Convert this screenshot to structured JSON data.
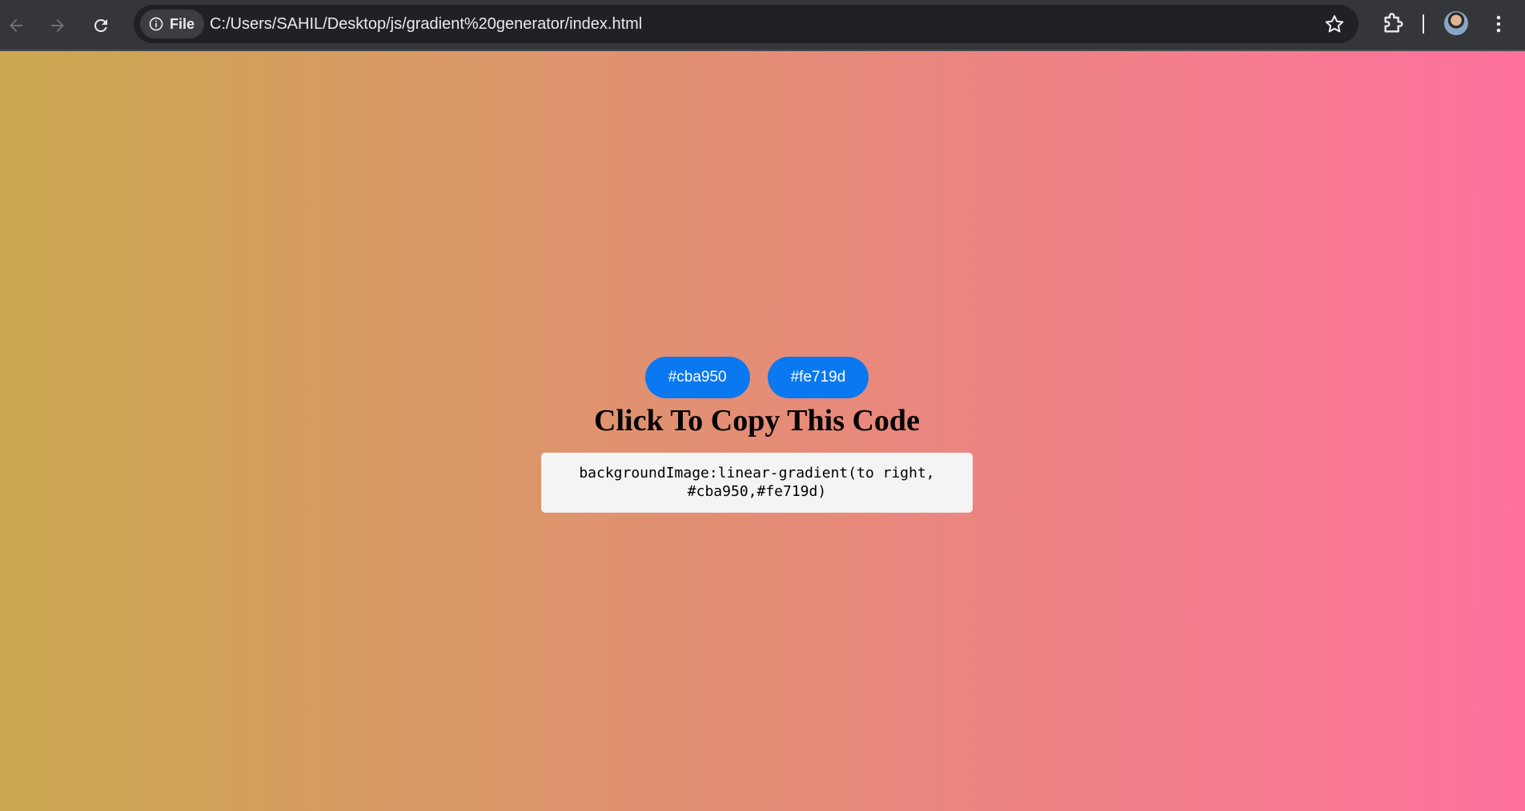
{
  "browser": {
    "site_chip_label": "File",
    "url": "C:/Users/SAHIL/Desktop/js/gradient%20generator/index.html",
    "icons": {
      "back": "arrow-left-icon",
      "forward": "arrow-right-icon",
      "reload": "reload-icon",
      "info": "info-icon",
      "bookmark": "star-icon",
      "extensions": "puzzle-piece-icon",
      "profile": "avatar",
      "menu": "kebab-menu-icon"
    }
  },
  "page": {
    "gradient": {
      "direction": "to right",
      "color_1": "#cba950",
      "color_2": "#fe719d"
    },
    "button_color": "#0a78f0",
    "color_buttons": [
      {
        "label": "#cba950"
      },
      {
        "label": "#fe719d"
      }
    ],
    "heading": "Click To Copy This Code",
    "code": "backgroundImage:linear-gradient(to right, #cba950,#fe719d)"
  }
}
